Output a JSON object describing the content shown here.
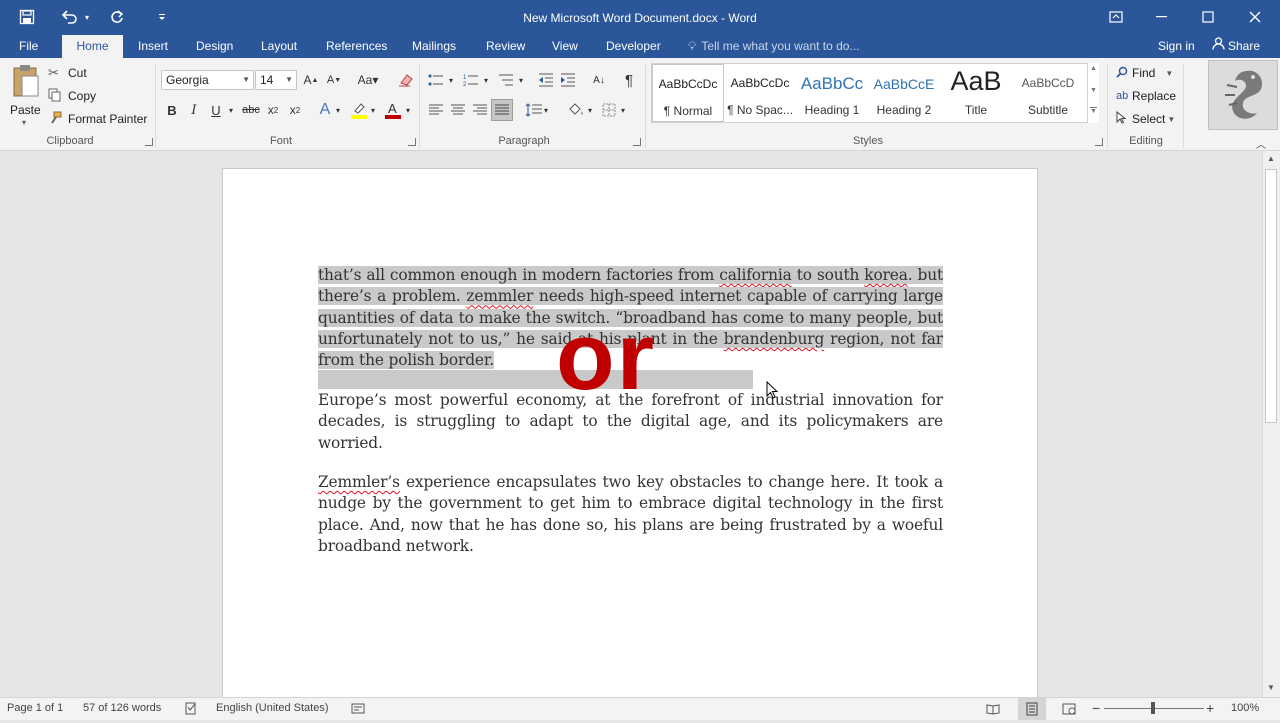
{
  "window": {
    "title": "New Microsoft Word Document.docx - Word"
  },
  "quick_access": [
    "save-icon",
    "undo-icon",
    "redo-icon",
    "customize-icon"
  ],
  "tabs": [
    {
      "label": "File"
    },
    {
      "label": "Home"
    },
    {
      "label": "Insert"
    },
    {
      "label": "Design"
    },
    {
      "label": "Layout"
    },
    {
      "label": "References"
    },
    {
      "label": "Mailings"
    },
    {
      "label": "Review"
    },
    {
      "label": "View"
    },
    {
      "label": "Developer"
    }
  ],
  "active_tab": "Home",
  "tell_me": "Tell me what you want to do...",
  "sign_in": "Sign in",
  "share": "Share",
  "clipboard": {
    "paste": "Paste",
    "cut": "Cut",
    "copy": "Copy",
    "format_painter": "Format Painter",
    "label": "Clipboard"
  },
  "font": {
    "name": "Georgia",
    "size": "14",
    "label": "Font"
  },
  "paragraph": {
    "label": "Paragraph"
  },
  "styles": {
    "label": "Styles",
    "items": [
      {
        "preview": "AaBbCcDc",
        "name": "¶ Normal"
      },
      {
        "preview": "AaBbCcDc",
        "name": "¶ No Spac..."
      },
      {
        "preview": "AaBbCc",
        "name": "Heading 1"
      },
      {
        "preview": "AaBbCcE",
        "name": "Heading 2"
      },
      {
        "preview": "AaB",
        "name": "Title"
      },
      {
        "preview": "AaBbCcD",
        "name": "Subtitle"
      }
    ]
  },
  "editing": {
    "find": "Find",
    "replace": "Replace",
    "select": "Select",
    "label": "Editing"
  },
  "document": {
    "p1_selected_a": "that’s all common enough in modern factories from ",
    "p1_w_california": "california",
    "p1_b": " to south ",
    "p1_w_korea": "korea",
    "p1_c": ". but there’s a problem. ",
    "p1_w_zemmler": "zemmler",
    "p1_d": " needs high-speed internet capable of carrying large quantities of data to make the switch. “broadband has come to many people, but unfortunately not to us,” he said at his plant in the ",
    "p1_w_brandenburg": "brandenburg",
    "p1_e": " region, not far from the polish border.",
    "p2": "Europe’s most powerful economy, at the forefront of industrial innovation for decades, is struggling to adapt to the digital age, and its policymakers are worried.",
    "p3_w_zemmlers": "Zemmler’s",
    "p3": " experience encapsulates two key obstacles to change here. It took a nudge by the government to get him to embrace digital technology in the first place. And, now that he has done so, his plans are being frustrated by a woeful broadband network.",
    "overlay_text": "or"
  },
  "status": {
    "page": "Page 1 of 1",
    "words": "57 of 126 words",
    "language": "English (United States)",
    "zoom": "100%",
    "zoom_level": 1.0
  },
  "colors": {
    "brand": "#2b579a",
    "selection": "#c9c9c9",
    "overlay": "#c00000",
    "spelling": "#e81123"
  }
}
